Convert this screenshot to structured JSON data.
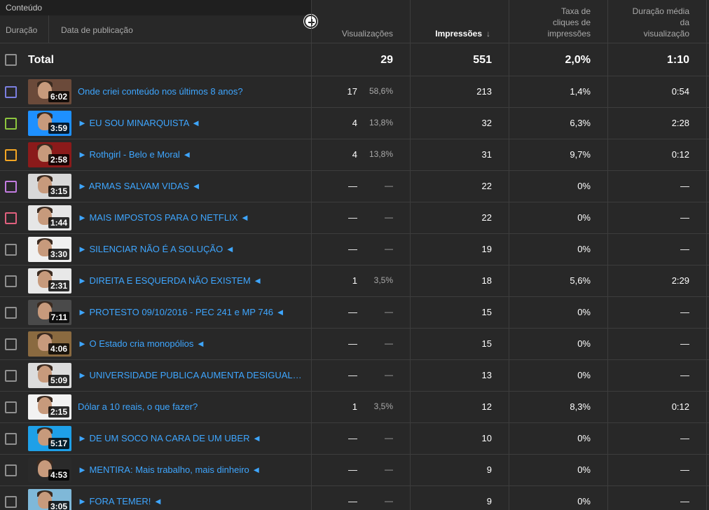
{
  "header": {
    "group_label": "Conteúdo",
    "duration_label": "Duração",
    "publish_date_label": "Data de publicação",
    "views_label": "Visualizações",
    "impressions_label": "Impressões",
    "impressions_sort_arrow": "↓",
    "ctr_label_lines": [
      "Taxa de",
      "cliques de",
      "impressões"
    ],
    "avg_duration_label_lines": [
      "Duração média",
      "da",
      "visualização"
    ]
  },
  "total": {
    "label": "Total",
    "views": "29",
    "impressions": "551",
    "ctr": "2,0%",
    "avg_duration": "1:10"
  },
  "rows": [
    {
      "checkbox_color": "#7b7fe0",
      "duration": "6:02",
      "title": "Onde criei conteúdo nos últimos 8 anos?",
      "views": "17",
      "views_pct": "58,6%",
      "impressions": "213",
      "ctr": "1,4%",
      "avg_duration": "0:54",
      "thumb_bg": "#6b4a3a"
    },
    {
      "checkbox_color": "#8dc63f",
      "duration": "3:59",
      "title": "► EU SOU MINARQUISTA ◄",
      "views": "4",
      "views_pct": "13,8%",
      "impressions": "32",
      "ctr": "6,3%",
      "avg_duration": "2:28",
      "thumb_bg": "#1e90ff"
    },
    {
      "checkbox_color": "#f5a623",
      "duration": "2:58",
      "title": "► Rothgirl - Belo e Moral ◄",
      "views": "4",
      "views_pct": "13,8%",
      "impressions": "31",
      "ctr": "9,7%",
      "avg_duration": "0:12",
      "thumb_bg": "#8b1a1a"
    },
    {
      "checkbox_color": "#c27ce0",
      "duration": "3:15",
      "title": "► ARMAS SALVAM VIDAS ◄",
      "views": "—",
      "views_pct": "—",
      "impressions": "22",
      "ctr": "0%",
      "avg_duration": "—",
      "thumb_bg": "#d8d8d8"
    },
    {
      "checkbox_color": "#e0607e",
      "duration": "1:44",
      "title": "► MAIS IMPOSTOS PARA O NETFLIX ◄",
      "views": "—",
      "views_pct": "—",
      "impressions": "22",
      "ctr": "0%",
      "avg_duration": "—",
      "thumb_bg": "#e6e6e6"
    },
    {
      "checkbox_color": "#909090",
      "duration": "3:30",
      "title": "► SILENCIAR NÃO É A SOLUÇÃO ◄",
      "views": "—",
      "views_pct": "—",
      "impressions": "19",
      "ctr": "0%",
      "avg_duration": "—",
      "thumb_bg": "#f0f0f0"
    },
    {
      "checkbox_color": "#909090",
      "duration": "2:31",
      "title": "► DIREITA E ESQUERDA NÃO EXISTEM ◄",
      "views": "1",
      "views_pct": "3,5%",
      "impressions": "18",
      "ctr": "5,6%",
      "avg_duration": "2:29",
      "thumb_bg": "#e8e8e8"
    },
    {
      "checkbox_color": "#909090",
      "duration": "7:11",
      "title": "► PROTESTO 09/10/2016 - PEC 241 e MP 746 ◄",
      "views": "—",
      "views_pct": "—",
      "impressions": "15",
      "ctr": "0%",
      "avg_duration": "—",
      "thumb_bg": "#4a4a4a"
    },
    {
      "checkbox_color": "#909090",
      "duration": "4:06",
      "title": "► O Estado cria monopólios ◄",
      "views": "—",
      "views_pct": "—",
      "impressions": "15",
      "ctr": "0%",
      "avg_duration": "—",
      "thumb_bg": "#8a6a40"
    },
    {
      "checkbox_color": "#909090",
      "duration": "5:09",
      "title": "► UNIVERSIDADE PUBLICA AUMENTA DESIGUALDADE ◄",
      "views": "—",
      "views_pct": "—",
      "impressions": "13",
      "ctr": "0%",
      "avg_duration": "—",
      "thumb_bg": "#dcdcdc"
    },
    {
      "checkbox_color": "#909090",
      "duration": "2:15",
      "title": "Dólar a 10 reais, o que fazer?",
      "views": "1",
      "views_pct": "3,5%",
      "impressions": "12",
      "ctr": "8,3%",
      "avg_duration": "0:12",
      "thumb_bg": "#f2f2f2"
    },
    {
      "checkbox_color": "#909090",
      "duration": "5:17",
      "title": "► DE UM SOCO NA CARA DE UM UBER ◄",
      "views": "—",
      "views_pct": "—",
      "impressions": "10",
      "ctr": "0%",
      "avg_duration": "—",
      "thumb_bg": "#1ea0e8"
    },
    {
      "checkbox_color": "#909090",
      "duration": "4:53",
      "title": "► MENTIRA: Mais trabalho, mais dinheiro ◄",
      "views": "—",
      "views_pct": "—",
      "impressions": "9",
      "ctr": "0%",
      "avg_duration": "—",
      "thumb_bg": "#2a2a2a"
    },
    {
      "checkbox_color": "#909090",
      "duration": "3:05",
      "title": "► FORA TEMER! ◄",
      "views": "—",
      "views_pct": "—",
      "impressions": "9",
      "ctr": "0%",
      "avg_duration": "—",
      "thumb_bg": "#7fb8d8"
    }
  ]
}
